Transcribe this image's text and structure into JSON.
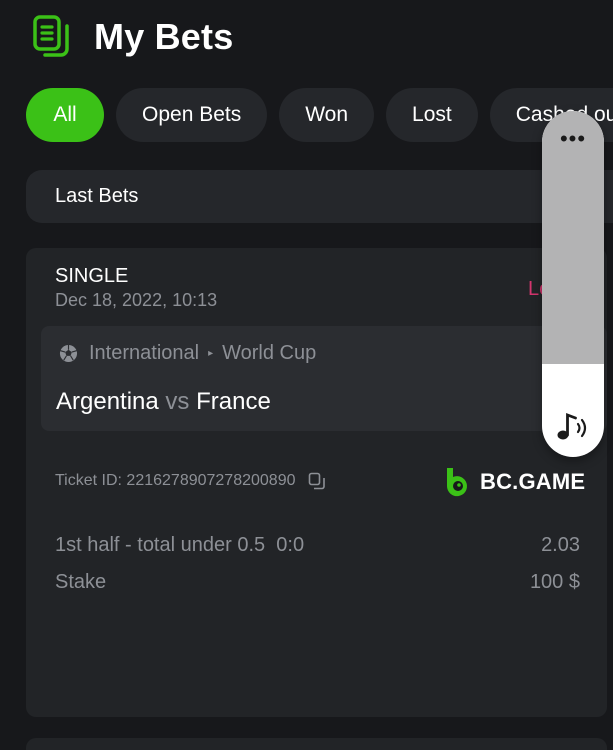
{
  "header": {
    "title": "My Bets",
    "icon": "receipt-icon"
  },
  "tabs": [
    {
      "label": "All",
      "active": true
    },
    {
      "label": "Open Bets",
      "active": false
    },
    {
      "label": "Won",
      "active": false
    },
    {
      "label": "Lost",
      "active": false
    },
    {
      "label": "Cashed out",
      "active": false
    }
  ],
  "last_bets": {
    "label": "Last Bets"
  },
  "bet": {
    "type": "SINGLE",
    "date": "Dec 18, 2022, 10:13",
    "status": "Lost",
    "league": {
      "region": "International",
      "competition": "World Cup",
      "icon": "soccer-ball-icon"
    },
    "teams": {
      "home": "Argentina",
      "vs": "vs",
      "away": "France"
    },
    "ticket": {
      "label": "Ticket ID:",
      "id": "2216278907278200890"
    },
    "brand": "BC.GAME",
    "selection": {
      "market": "1st half - total under 0.5",
      "score": "0:0",
      "odds": "2.03"
    },
    "stake": {
      "label": "Stake",
      "value": "100 $"
    }
  },
  "overlay": {
    "more": "•••",
    "icon": "music-note-icon",
    "level": 0.27
  },
  "colors": {
    "accent": "#3bc117",
    "lost": "#d4356e",
    "background": "#17181b",
    "card": "#222427"
  }
}
